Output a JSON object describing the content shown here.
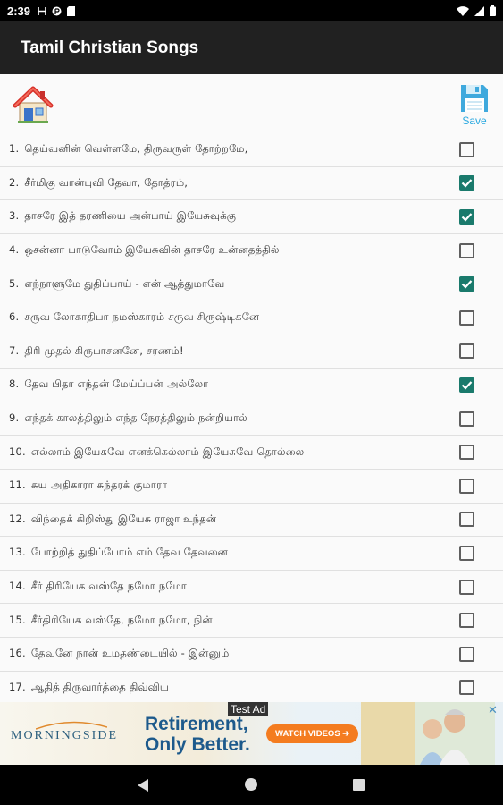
{
  "status_bar": {
    "time": "2:39"
  },
  "app": {
    "title": "Tamil Christian Songs"
  },
  "toolbar": {
    "save_label": "Save"
  },
  "songs": [
    {
      "num": "1.",
      "title": "தெய்வனின் வெள்ளமே, திருவருள் தோற்றமே,",
      "checked": false
    },
    {
      "num": "2.",
      "title": "சீர்மிகு வான்புவி தேவா, தோத்ரம்,",
      "checked": true
    },
    {
      "num": "3.",
      "title": "தாசரே இத் தரணியை அன்பாய் இயேசுவுக்கு",
      "checked": true
    },
    {
      "num": "4.",
      "title": "ஒசன்னா பாடுவோம் இயேசுவின் தாசரே உன்னதத்தில்",
      "checked": false
    },
    {
      "num": "5.",
      "title": "எந்நாளுமே துதிப்பாய் - என் ஆத்துமாவே",
      "checked": true
    },
    {
      "num": "6.",
      "title": "சருவ லோகாதிபா நமஸ்காரம் சருவ சிருஷ்டிகனே",
      "checked": false
    },
    {
      "num": "7.",
      "title": "திரி முதல் கிருபாசனனே, சரணம்!",
      "checked": false
    },
    {
      "num": "8.",
      "title": "தேவ பிதா எந்தன் மேய்ப்பன் அல்லோ",
      "checked": true
    },
    {
      "num": "9.",
      "title": "எந்தக் காலத்திலும் எந்த நேரத்திலும் நன்றியால்",
      "checked": false
    },
    {
      "num": "10.",
      "title": "எல்லாம் இயேசுவே எனக்கெல்லாம் இயேசுவே தொல்லை",
      "checked": false
    },
    {
      "num": "11.",
      "title": "சுய அதிகாரா சுந்தரக் குமாரா",
      "checked": false
    },
    {
      "num": "12.",
      "title": "விந்தைக் கிறிஸ்து இயேசு ராஜா உந்தன்",
      "checked": false
    },
    {
      "num": "13.",
      "title": "போற்றித் துதிப்போம் எம் தேவ தேவனை",
      "checked": false
    },
    {
      "num": "14.",
      "title": "சீர் திரியேக வஸ்தே நமோ நமோ",
      "checked": false
    },
    {
      "num": "15.",
      "title": "சீர்திரியேக வஸ்தே, நமோ நமோ, நின்",
      "checked": false
    },
    {
      "num": "16.",
      "title": "தேவனே நான் உமதண்டையில் - இன்னும்",
      "checked": false
    },
    {
      "num": "17.",
      "title": "ஆதித் திருவார்த்தை திவ்விய",
      "checked": false
    }
  ],
  "ad": {
    "tag": "Test Ad",
    "brand": "MORNINGSIDE",
    "headline_line1": "Retirement,",
    "headline_line2": "Only Better.",
    "cta": "WATCH VIDEOS ➔",
    "close": "✕"
  },
  "colors": {
    "app_bar": "#212121",
    "checkbox_checked": "#1a7a6c",
    "save_accent": "#29a8e0"
  },
  "icons": {
    "home": "house-icon",
    "save": "floppy-disk-icon",
    "wifi": "wifi-icon",
    "signal": "signal-icon",
    "battery": "battery-icon"
  }
}
